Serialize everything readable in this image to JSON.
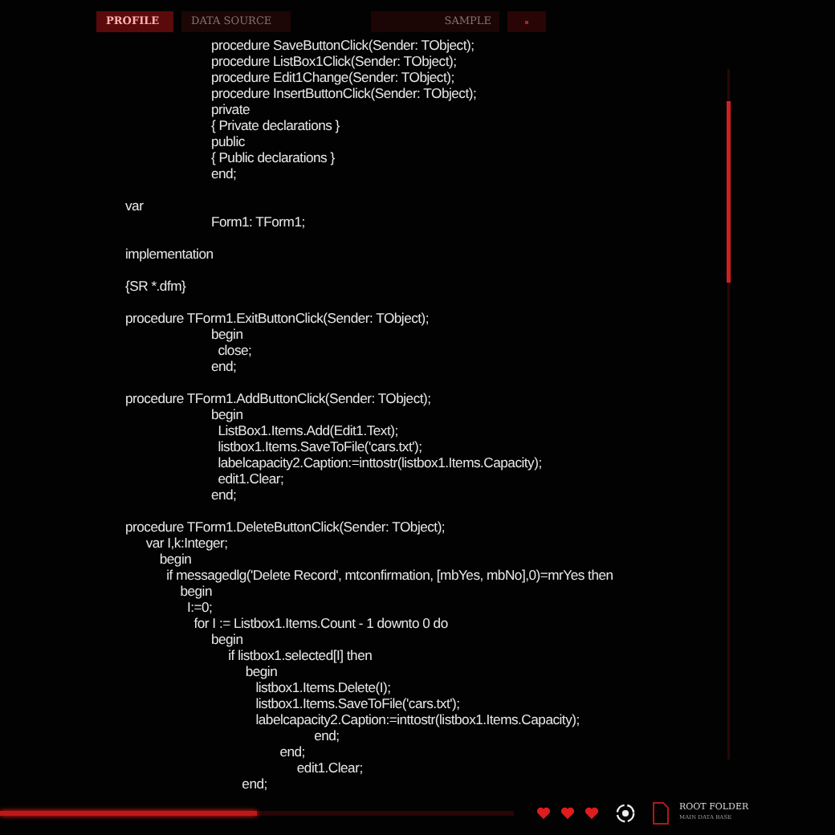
{
  "tabs": [
    {
      "label": "PROFILE",
      "selected": true
    },
    {
      "label": "DATA SOURCE",
      "selected": false
    }
  ],
  "sample_field": {
    "value": "SAMPLE"
  },
  "code_blocks": [
    [
      "                         procedure SaveButtonClick(Sender: TObject);",
      "                         procedure ListBox1Click(Sender: TObject);",
      "                         procedure Edit1Change(Sender: TObject);",
      "                         procedure InsertButtonClick(Sender: TObject);",
      "                         private",
      "                         { Private declarations }",
      "                         public",
      "                         { Public declarations }",
      "                         end;"
    ],
    [
      "var",
      "                         Form1: TForm1;"
    ],
    [
      "implementation"
    ],
    [
      "{SR *.dfm}"
    ],
    [
      "procedure TForm1.ExitButtonClick(Sender: TObject);",
      "                         begin",
      "                           close;",
      "                         end;"
    ],
    [
      "procedure TForm1.AddButtonClick(Sender: TObject);",
      "                         begin",
      "                           ListBox1.Items.Add(Edit1.Text);",
      "                           listbox1.Items.SaveToFile('cars.txt');",
      "                           labelcapacity2.Caption:=inttostr(listbox1.Items.Capacity);",
      "                           edit1.Clear;",
      "                         end;"
    ],
    [
      "procedure TForm1.DeleteButtonClick(Sender: TObject);",
      "      var I,k:Integer;",
      "          begin",
      "            if messagedlg('Delete Record', mtconfirmation, [mbYes, mbNo],0)=mrYes then",
      "                begin",
      "                  I:=0;",
      "                    for I := Listbox1.Items.Count - 1 downto 0 do",
      "                         begin",
      "                              if listbox1.selected[I] then",
      "                                   begin",
      "                                      listbox1.Items.Delete(I);",
      "                                      listbox1.Items.SaveToFile('cars.txt');",
      "                                      labelcapacity2.Caption:=inttostr(listbox1.Items.Capacity);",
      "                                                       end;",
      "                                             end;",
      "                                                  edit1.Clear;",
      "                                  end;"
    ]
  ],
  "progress": {
    "level": 0.5
  },
  "folder": {
    "title": "ROOT FOLDER",
    "subtitle": "MAIN DATA BASE"
  }
}
